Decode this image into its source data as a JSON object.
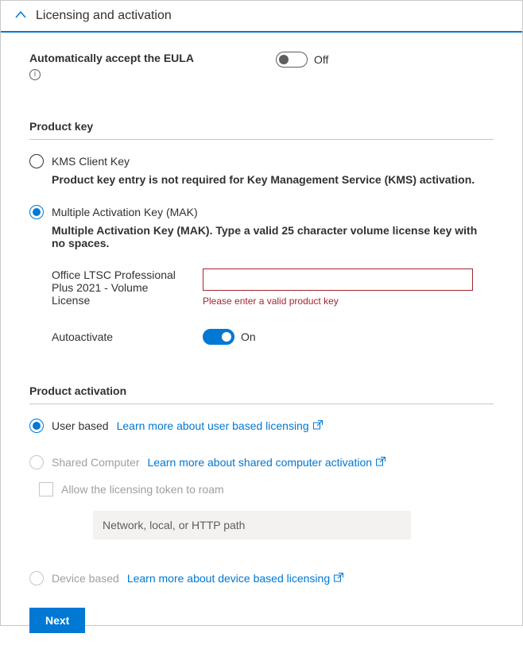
{
  "header": {
    "title": "Licensing and activation"
  },
  "eula": {
    "label": "Automatically accept the EULA",
    "state": "Off"
  },
  "productKey": {
    "sectionTitle": "Product key",
    "kms": {
      "label": "KMS Client Key",
      "desc": "Product key entry is not required for Key Management Service (KMS) activation."
    },
    "mak": {
      "label": "Multiple Activation Key (MAK)",
      "desc": "Multiple Activation Key (MAK). Type a valid 25 character volume license key with no spaces.",
      "productName": "Office LTSC Professional Plus 2021 - Volume License",
      "value": "",
      "error": "Please enter a valid product key",
      "autoLabel": "Autoactivate",
      "autoState": "On"
    }
  },
  "activation": {
    "sectionTitle": "Product activation",
    "userBased": {
      "label": "User based",
      "link": "Learn more about user based licensing"
    },
    "sharedComputer": {
      "label": "Shared Computer",
      "link": "Learn more about shared computer activation",
      "roamLabel": "Allow the licensing token to roam",
      "pathPlaceholder": "Network, local, or HTTP path"
    },
    "deviceBased": {
      "label": "Device based",
      "link": "Learn more about device based licensing"
    }
  },
  "footer": {
    "next": "Next"
  }
}
